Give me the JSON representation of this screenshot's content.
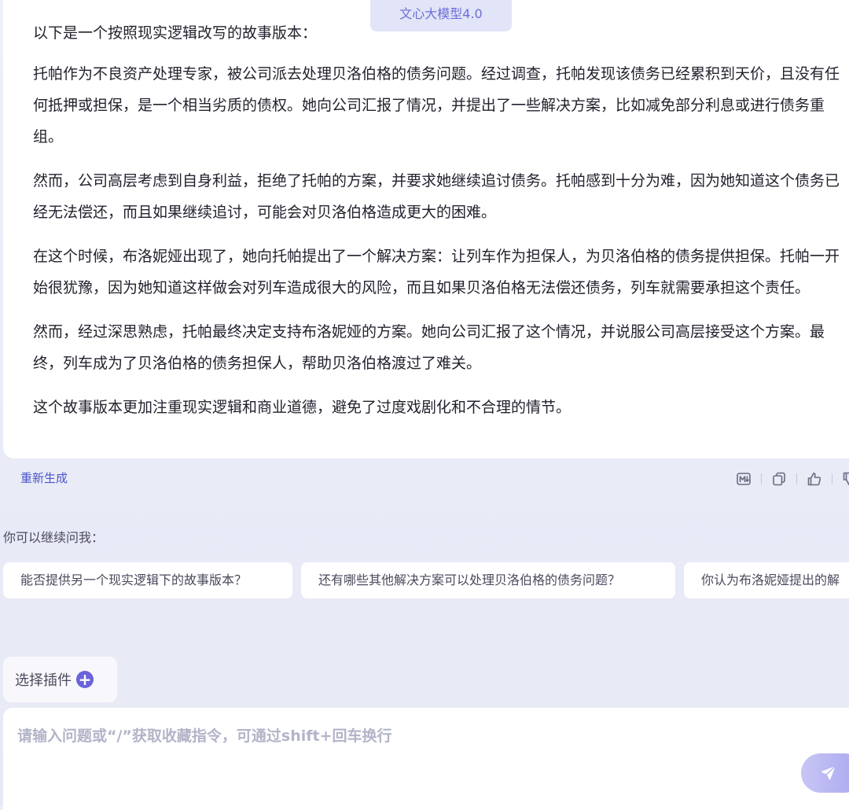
{
  "model_badge": "文心大模型4.0",
  "answer": {
    "intro": "以下是一个按照现实逻辑改写的故事版本：",
    "paragraphs": [
      "托帕作为不良资产处理专家，被公司派去处理贝洛伯格的债务问题。经过调查，托帕发现该债务已经累积到天价，且没有任何抵押或担保，是一个相当劣质的债权。她向公司汇报了情况，并提出了一些解决方案，比如减免部分利息或进行债务重组。",
      "然而，公司高层考虑到自身利益，拒绝了托帕的方案，并要求她继续追讨债务。托帕感到十分为难，因为她知道这个债务已经无法偿还，而且如果继续追讨，可能会对贝洛伯格造成更大的困难。",
      "在这个时候，布洛妮娅出现了，她向托帕提出了一个解决方案：让列车作为担保人，为贝洛伯格的债务提供担保。托帕一开始很犹豫，因为她知道这样做会对列车造成很大的风险，而且如果贝洛伯格无法偿还债务，列车就需要承担这个责任。",
      "然而，经过深思熟虑，托帕最终决定支持布洛妮娅的方案。她向公司汇报了这个情况，并说服公司高层接受这个方案。最终，列车成为了贝洛伯格的债务担保人，帮助贝洛伯格渡过了难关。",
      "这个故事版本更加注重现实逻辑和商业道德，避免了过度戏剧化和不合理的情节。"
    ]
  },
  "actions": {
    "regenerate_label": "重新生成",
    "icons": [
      "markdown-icon",
      "copy-icon",
      "thumbs-up-icon",
      "thumbs-down-icon"
    ]
  },
  "suggestions": {
    "label": "你可以继续问我：",
    "items": [
      "能否提供另一个现实逻辑下的故事版本？",
      "还有哪些其他解决方案可以处理贝洛伯格的债务问题？",
      "你认为布洛妮娅提出的解"
    ]
  },
  "plugin": {
    "label": "选择插件",
    "icon": "plus-circle-icon"
  },
  "input": {
    "value": "",
    "placeholder": "请输入问题或“/”获取收藏指令，可通过shift+回车换行",
    "send_icon": "paper-plane-icon"
  },
  "colors": {
    "accent": "#6b63d8",
    "link": "#4b55c8",
    "background": "#eceef8"
  }
}
